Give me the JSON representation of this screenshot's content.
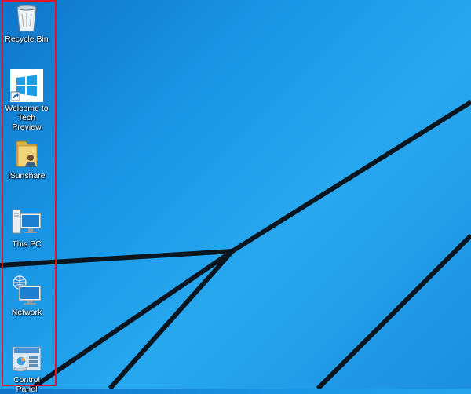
{
  "desktop": {
    "icons": [
      {
        "label": "Recycle Bin",
        "icon": "recycle-bin-icon"
      },
      {
        "label": "Welcome to Tech Preview",
        "icon": "windows-logo-shortcut-icon"
      },
      {
        "label": "iSunshare",
        "icon": "user-folder-icon"
      },
      {
        "label": "This PC",
        "icon": "this-pc-icon"
      },
      {
        "label": "Network",
        "icon": "network-icon"
      },
      {
        "label": "Control Panel",
        "icon": "control-panel-icon"
      }
    ]
  },
  "colors": {
    "wallpaper_blue": "#1a97e6",
    "highlight_border": "#e0142b",
    "line": "#0b1520"
  }
}
